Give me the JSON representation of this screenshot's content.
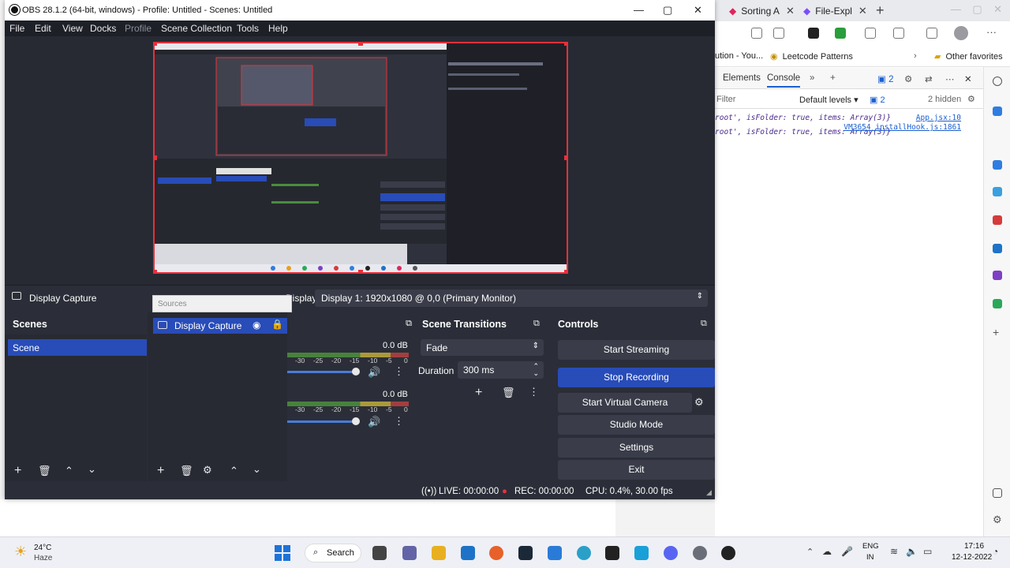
{
  "obs": {
    "title": "OBS 28.1.2 (64-bit, windows) - Profile: Untitled - Scenes: Untitled",
    "menu": [
      "File",
      "Edit",
      "View",
      "Docks",
      "Profile",
      "Scene Collection",
      "Tools",
      "Help"
    ],
    "source_bar": {
      "source_name": "Display Capture",
      "display_label": "Display",
      "display_value": "Display 1: 1920x1080 @ 0,0 (Primary Monitor)"
    },
    "scenes": {
      "title": "Scenes",
      "items": [
        "Scene"
      ]
    },
    "sources": {
      "floating_label": "Sources",
      "items": [
        "Display Capture"
      ]
    },
    "mixer": {
      "channels": [
        {
          "db": "0.0 dB"
        },
        {
          "db": "0.0 dB"
        }
      ],
      "ticks": [
        "-30",
        "-25",
        "-20",
        "-15",
        "-10",
        "-5",
        "0"
      ]
    },
    "transitions": {
      "title": "Scene Transitions",
      "selected": "Fade",
      "duration_label": "Duration",
      "duration_value": "300 ms"
    },
    "controls": {
      "title": "Controls",
      "start_streaming": "Start Streaming",
      "stop_recording": "Stop Recording",
      "start_virtual_camera": "Start Virtual Camera",
      "studio_mode": "Studio Mode",
      "settings": "Settings",
      "exit": "Exit"
    },
    "status": {
      "live": "LIVE: 00:00:00",
      "rec": "REC: 00:00:00",
      "cpu": "CPU: 0.4%, 30.00 fps"
    }
  },
  "browser": {
    "tabs": [
      "Sorting A",
      "File-Expl"
    ],
    "bookmarks": [
      "ution - You...",
      "Leetcode Patterns",
      "Other favorites"
    ],
    "devtools": {
      "tabs": [
        "Elements",
        "Console"
      ],
      "badge": "2",
      "filter_placeholder": "Filter",
      "levels": "Default levels",
      "levels_badge": "2",
      "hidden": "2 hidden",
      "logs": [
        {
          "text": "root', isFolder: true, items: Array(3)}",
          "src": "App.jsx:10"
        },
        {
          "text": "root', isFolder: true, items: Array(3)}",
          "src": "VM3654 installHook.js:1861"
        }
      ]
    }
  },
  "taskbar": {
    "weather_temp": "24°C",
    "weather_desc": "Haze",
    "search": "Search",
    "lang": "ENG",
    "region": "IN",
    "time": "17:16",
    "date": "12-12-2022"
  },
  "colors": {
    "accent": "#284cb8",
    "record_red": "#e8303a",
    "obs_bg": "#2b2e38"
  }
}
